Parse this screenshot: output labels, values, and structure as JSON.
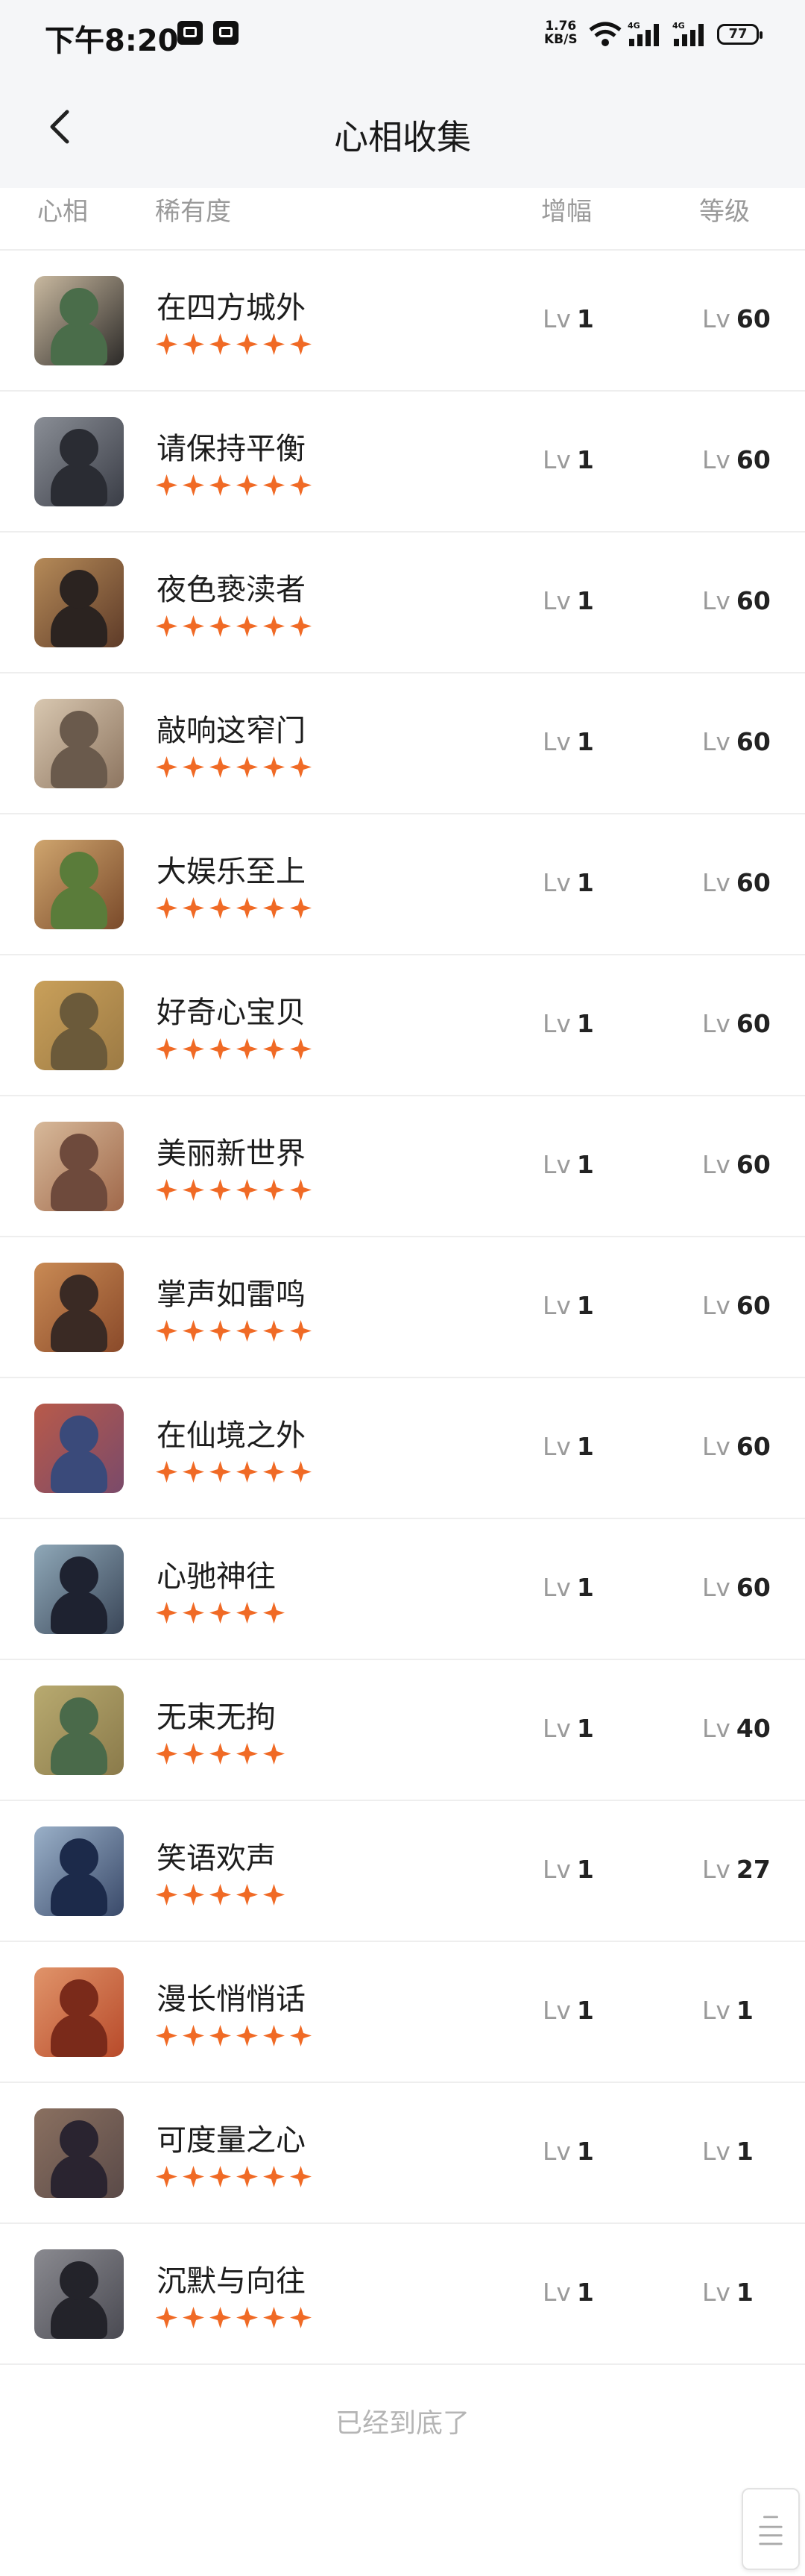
{
  "status_bar": {
    "time": "下午8:20",
    "speed": "1.76",
    "speed_unit": "KB/S",
    "net1": "4G",
    "net2": "4G",
    "battery": "77"
  },
  "nav": {
    "title": "心相收集"
  },
  "columns": {
    "heart": "心相",
    "rarity": "稀有度",
    "gain": "增幅",
    "level": "等级"
  },
  "lv_prefix": "Lv",
  "accent": "#f06a25",
  "rows": [
    {
      "name": "在四方城外",
      "stars": 6,
      "gain": "1",
      "level": "60",
      "c1": "#c9b9a0",
      "c2": "#4a6d4a",
      "c3": "#2c2a28"
    },
    {
      "name": "请保持平衡",
      "stars": 6,
      "gain": "1",
      "level": "60",
      "c1": "#8a8e96",
      "c2": "#2a2c33",
      "c3": "#3a3d46"
    },
    {
      "name": "夜色亵渎者",
      "stars": 6,
      "gain": "1",
      "level": "60",
      "c1": "#b58a58",
      "c2": "#2b2320",
      "c3": "#5e3b28"
    },
    {
      "name": "敲响这窄门",
      "stars": 6,
      "gain": "1",
      "level": "60",
      "c1": "#d8c7b0",
      "c2": "#6a5a4c",
      "c3": "#8d7560"
    },
    {
      "name": "大娱乐至上",
      "stars": 6,
      "gain": "1",
      "level": "60",
      "c1": "#cfa56e",
      "c2": "#5a7c3a",
      "c3": "#7a4a2a"
    },
    {
      "name": "好奇心宝贝",
      "stars": 6,
      "gain": "1",
      "level": "60",
      "c1": "#c9a05a",
      "c2": "#6b5a3a",
      "c3": "#9c7a44"
    },
    {
      "name": "美丽新世界",
      "stars": 6,
      "gain": "1",
      "level": "60",
      "c1": "#d7b99a",
      "c2": "#6e4a3c",
      "c3": "#a0684a"
    },
    {
      "name": "掌声如雷鸣",
      "stars": 6,
      "gain": "1",
      "level": "60",
      "c1": "#c98a54",
      "c2": "#3a2a24",
      "c3": "#8a4a2a"
    },
    {
      "name": "在仙境之外",
      "stars": 6,
      "gain": "1",
      "level": "60",
      "c1": "#b85a4a",
      "c2": "#3a4a7a",
      "c3": "#7a4a6a"
    },
    {
      "name": "心驰神往",
      "stars": 5,
      "gain": "1",
      "level": "60",
      "c1": "#8fa8b8",
      "c2": "#1e2230",
      "c3": "#3a4658"
    },
    {
      "name": "无束无拘",
      "stars": 5,
      "gain": "1",
      "level": "40",
      "c1": "#b8aa70",
      "c2": "#4a6a4a",
      "c3": "#8a7a4a"
    },
    {
      "name": "笑语欢声",
      "stars": 5,
      "gain": "1",
      "level": "27",
      "c1": "#9ab0c8",
      "c2": "#1c2a4a",
      "c3": "#3a4a6a"
    },
    {
      "name": "漫长悄悄话",
      "stars": 6,
      "gain": "1",
      "level": "1",
      "c1": "#e0946a",
      "c2": "#7a2a1a",
      "c3": "#b84a2a"
    },
    {
      "name": "可度量之心",
      "stars": 6,
      "gain": "1",
      "level": "1",
      "c1": "#8a7060",
      "c2": "#2a2430",
      "c3": "#5a4a48"
    },
    {
      "name": "沉默与向往",
      "stars": 6,
      "gain": "1",
      "level": "1",
      "c1": "#8a8a90",
      "c2": "#23232a",
      "c3": "#4a4a52"
    }
  ],
  "footer": {
    "end_text": "已经到底了"
  }
}
